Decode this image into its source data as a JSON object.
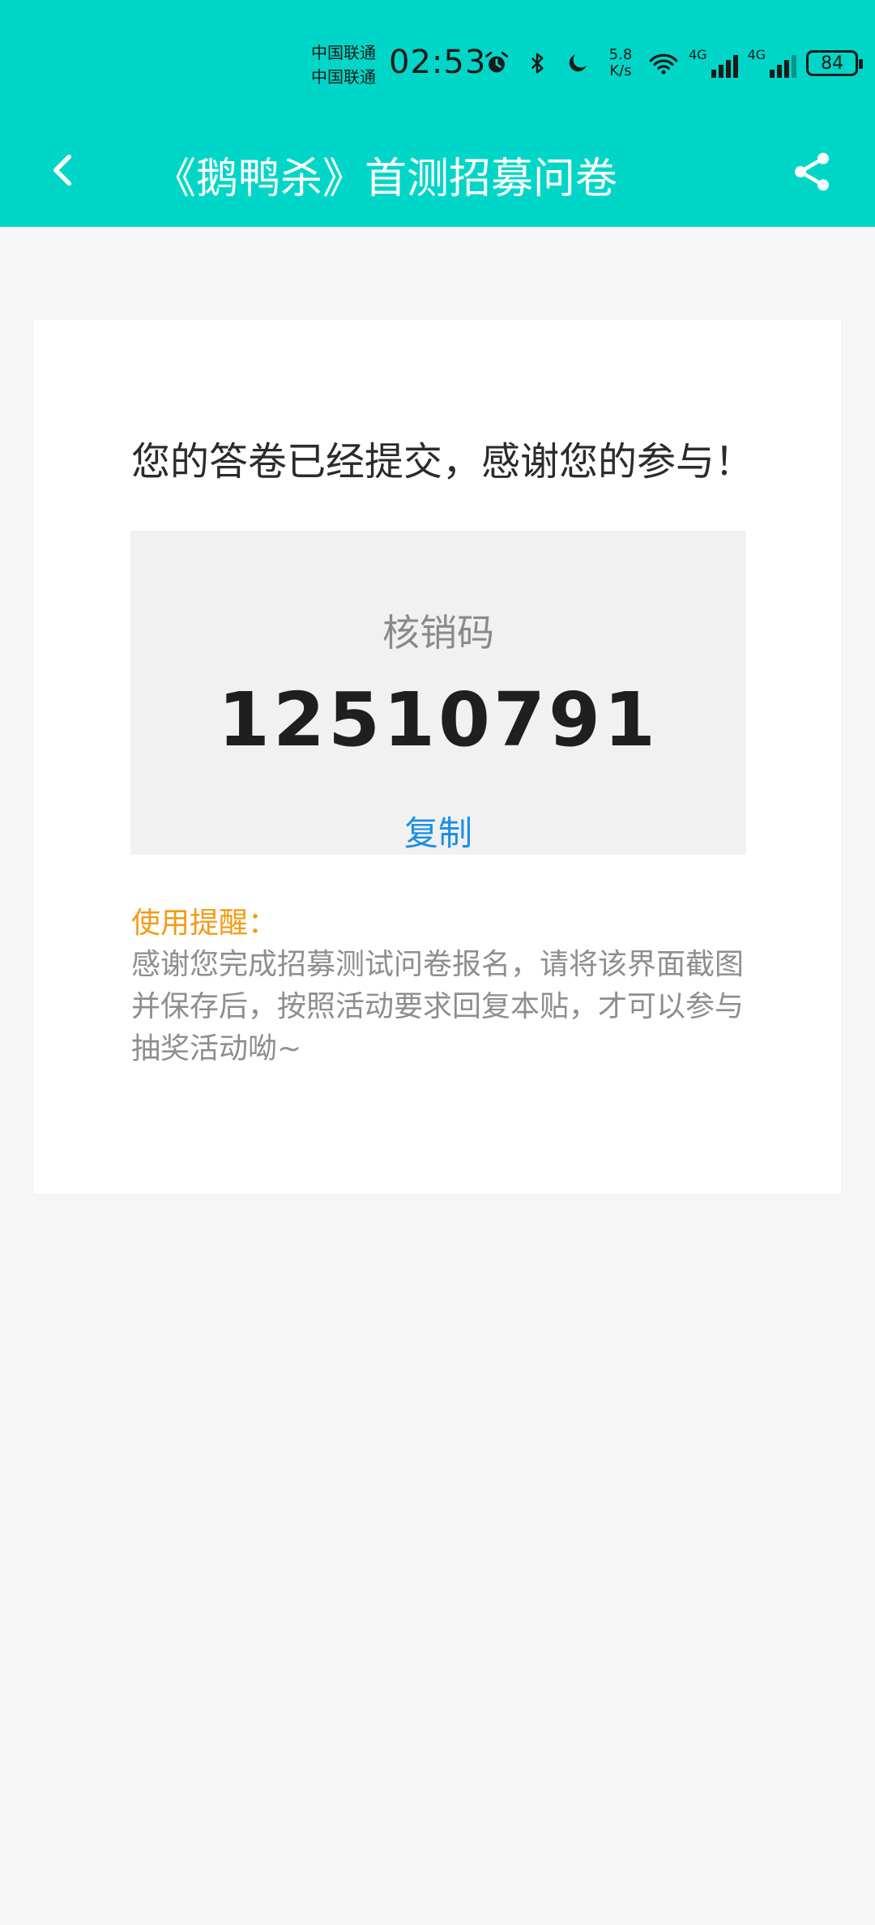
{
  "status_bar": {
    "carrier_1": "中国联通",
    "carrier_2": "中国联通",
    "time": "02:53",
    "speed_value": "5.8",
    "speed_unit": "K/s",
    "network_1_label": "4G",
    "network_2_label": "4G",
    "battery_level": "84",
    "icons": [
      "alarm-icon",
      "bluetooth-icon",
      "moon-icon",
      "wifi-icon",
      "signal-icon",
      "signal-icon",
      "battery-icon"
    ]
  },
  "app_bar": {
    "title": "《鹅鸭杀》首测招募问卷",
    "back_icon": "chevron-left-icon",
    "share_icon": "share-icon",
    "background_color": "#00d6c7"
  },
  "main": {
    "headline": "您的答卷已经提交，感谢您的参与！",
    "verification": {
      "label": "核销码",
      "code": "12510791",
      "copy_label": "复制",
      "copy_color": "#1a8fe6"
    },
    "reminder": {
      "title": "使用提醒：",
      "title_color": "#f29b16",
      "body": "感谢您完成招募测试问卷报名，请将该界面截图并保存后，按照活动要求回复本贴，才可以参与抽奖活动呦~"
    }
  }
}
